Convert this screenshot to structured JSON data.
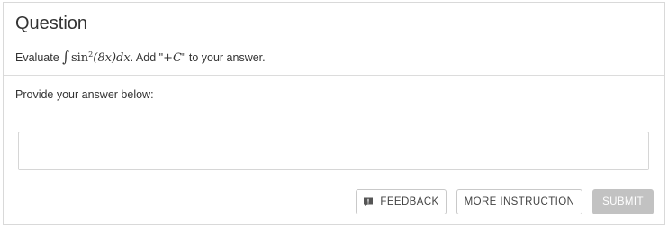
{
  "question": {
    "title": "Question",
    "prefix": "Evaluate",
    "integral_symbol": "∫",
    "func": "sin",
    "exponent": "2",
    "arg": "(8x)dx",
    "middle": ". Add \"",
    "plus_c": "+C",
    "suffix": "\" to your answer."
  },
  "prompt": {
    "text": "Provide your answer below:"
  },
  "answer": {
    "value": "",
    "placeholder": ""
  },
  "buttons": {
    "feedback": "FEEDBACK",
    "more_instruction": "MORE INSTRUCTION",
    "submit": "SUBMIT"
  },
  "icons": {
    "feedback_icon": "comment-alert-icon"
  },
  "colors": {
    "submit_disabled_bg": "#c2c2c2",
    "border": "#d9d9d9"
  }
}
